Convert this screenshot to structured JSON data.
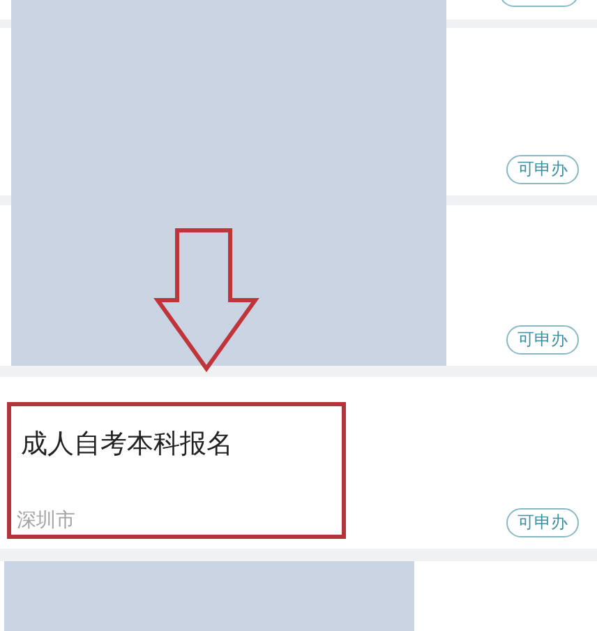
{
  "cards": [
    {
      "kind": "cut"
    },
    {
      "kind": "redacted",
      "badge": "可申办"
    },
    {
      "kind": "redacted",
      "badge": "可申办"
    },
    {
      "kind": "service",
      "title": "成人自考本科报名",
      "location": "深圳市",
      "badge": "可申办",
      "highlighted": true
    },
    {
      "kind": "redacted_tail"
    }
  ],
  "annotations": [
    {
      "kind": "arrow"
    }
  ]
}
